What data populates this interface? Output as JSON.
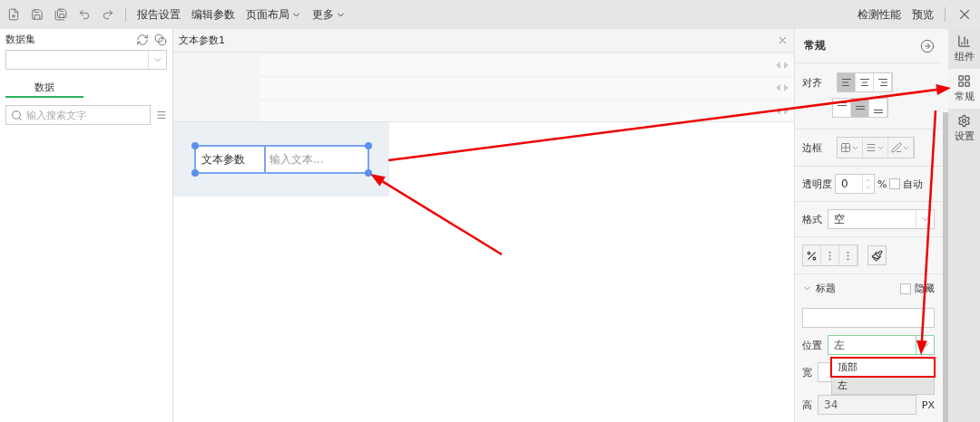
{
  "toolbar": {
    "menus": [
      {
        "label": "报告设置",
        "kind": "plain"
      },
      {
        "label": "编辑参数",
        "kind": "plain"
      },
      {
        "label": "页面布局",
        "kind": "menu"
      },
      {
        "label": "更多",
        "kind": "menu"
      }
    ],
    "actions": [
      "检测性能",
      "预览"
    ]
  },
  "left_panel": {
    "dataset_label": "数据集",
    "tabs": [
      {
        "label": "数据",
        "selected": true
      }
    ],
    "search": {
      "placeholder": "输入搜索文字"
    }
  },
  "editor": {
    "tab_title": "文本参数1",
    "param_widget": {
      "label": "文本参数",
      "placeholder": "输入文本..."
    }
  },
  "properties": {
    "title": "常规",
    "align_label": "对齐",
    "h_align": [
      {
        "selected": true
      },
      {
        "selected": false
      },
      {
        "selected": false
      }
    ],
    "v_align": [
      {
        "selected": false
      },
      {
        "selected": true
      },
      {
        "selected": false
      }
    ],
    "border_label": "边框",
    "opacity": {
      "label": "透明度",
      "value": "0",
      "unit": "%",
      "auto_label": "自动",
      "auto_checked": false
    },
    "format": {
      "label": "格式",
      "value": "空"
    },
    "title_section": {
      "label": "标题",
      "expanded": true,
      "hide_label": "隐藏",
      "hide_checked": false
    },
    "position": {
      "label": "位置",
      "value": "左",
      "options": [
        {
          "label": "顶部",
          "selected": false
        },
        {
          "label": "左",
          "selected": true
        }
      ]
    },
    "width_label": "宽",
    "height": {
      "label": "高",
      "value": "34",
      "unit": "PX",
      "disabled": true
    }
  },
  "side_tabs": [
    {
      "label": "组件",
      "kind": "component",
      "selected": false
    },
    {
      "label": "常规",
      "kind": "general",
      "selected": true
    },
    {
      "label": "设置",
      "kind": "settings",
      "selected": false
    }
  ]
}
